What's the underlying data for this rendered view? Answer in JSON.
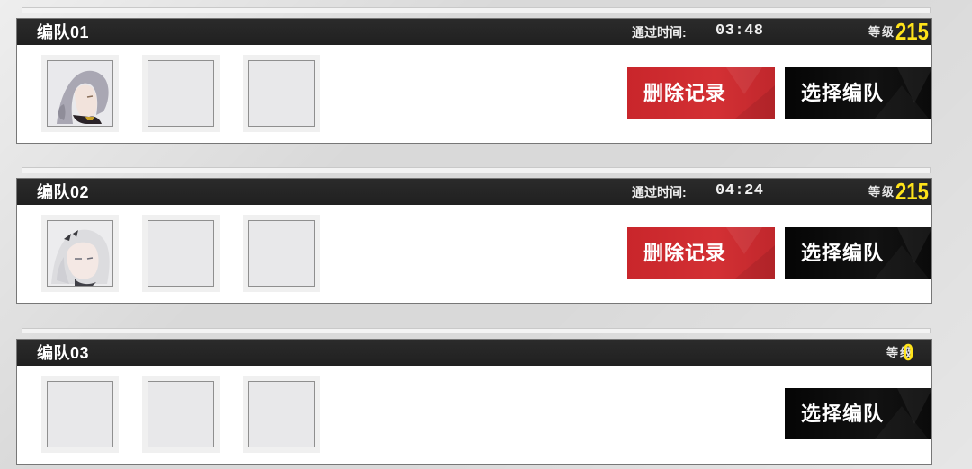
{
  "teams": [
    {
      "name": "编队01",
      "time_label": "通过时间:",
      "time_value": "03:48",
      "level_label": "等级",
      "level_value": "215",
      "delete_label": "删除记录",
      "select_label": "选择编队",
      "slots": [
        "portrait-gray-hair",
        "empty",
        "empty"
      ]
    },
    {
      "name": "编队02",
      "time_label": "通过时间:",
      "time_value": "04:24",
      "level_label": "等级",
      "level_value": "215",
      "delete_label": "删除记录",
      "select_label": "选择编队",
      "slots": [
        "portrait-white-hair",
        "empty",
        "empty"
      ]
    },
    {
      "name": "编队03",
      "level_label": "等级",
      "level_value": "0",
      "select_label": "选择编队",
      "slots": [
        "empty",
        "empty",
        "empty"
      ]
    }
  ],
  "colors": {
    "header_bg": "#262626",
    "level_yellow": "#ffe31a",
    "delete_red": "#cf2d31",
    "select_black": "#0b0b0b"
  }
}
